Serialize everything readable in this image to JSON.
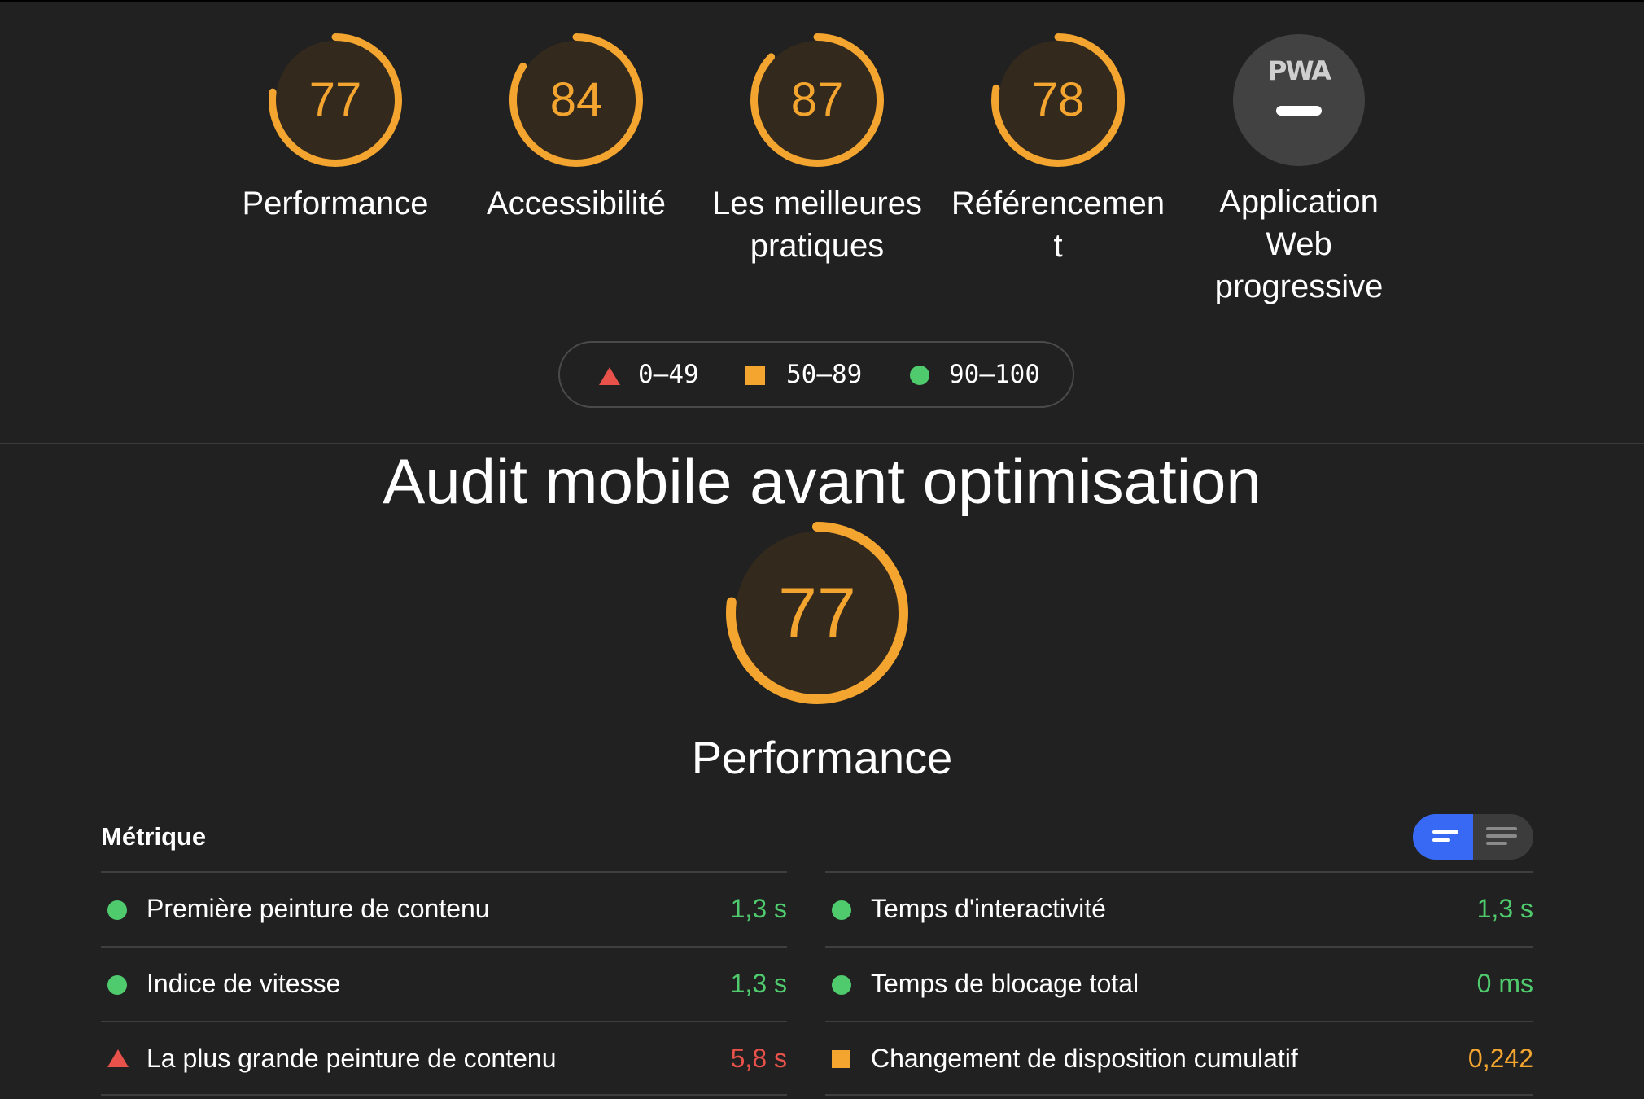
{
  "colors": {
    "pass": "#4fcb6e",
    "average": "#f4a530",
    "fail": "#e9524a",
    "toggle_active": "#3769f5"
  },
  "categories": [
    {
      "score": "77",
      "label": "Performance",
      "value": 77
    },
    {
      "score": "84",
      "label": "Accessibilité",
      "value": 84
    },
    {
      "score": "87",
      "label": "Les meilleures pratiques",
      "value": 87
    },
    {
      "score": "78",
      "label": "Référencement",
      "value": 78
    },
    {
      "badge": "PWA",
      "label": "Application Web progressive"
    }
  ],
  "legend": {
    "fail": "0–49",
    "average": "50–89",
    "pass": "90–100"
  },
  "title": "Audit mobile avant optimisation",
  "main_gauge": {
    "score": "77",
    "value": 77,
    "label": "Performance"
  },
  "metrics": {
    "header": "Métrique",
    "left": [
      {
        "label": "Première peinture de contenu",
        "value": "1,3 s",
        "status": "pass"
      },
      {
        "label": "Indice de vitesse",
        "value": "1,3 s",
        "status": "pass"
      },
      {
        "label": "La plus grande peinture de contenu",
        "value": "5,8 s",
        "status": "fail"
      }
    ],
    "right": [
      {
        "label": "Temps d'interactivité",
        "value": "1,3 s",
        "status": "pass"
      },
      {
        "label": "Temps de blocage total",
        "value": "0 ms",
        "status": "pass"
      },
      {
        "label": "Changement de disposition cumulatif",
        "value": "0,242",
        "status": "average"
      }
    ]
  }
}
